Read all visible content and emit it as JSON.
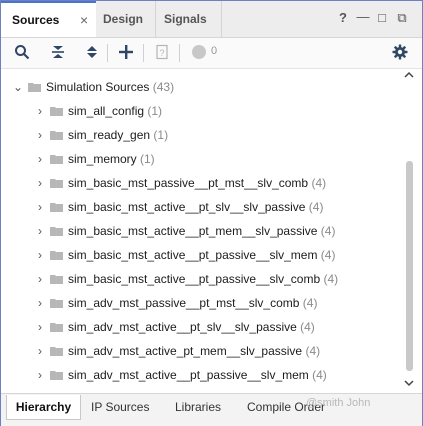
{
  "tabs": {
    "sources": "Sources",
    "design": "Design",
    "signals": "Signals",
    "close_glyph": "×"
  },
  "window_controls": {
    "help": "?",
    "minimize": "—",
    "maximize": "□",
    "restore": "⧉"
  },
  "toolbar": {
    "message_count": "0"
  },
  "tree": {
    "root": {
      "label": "Simulation Sources",
      "count": "(43)"
    },
    "items": [
      {
        "label": "sim_all_config",
        "count": "(1)"
      },
      {
        "label": "sim_ready_gen",
        "count": "(1)"
      },
      {
        "label": "sim_memory",
        "count": "(1)"
      },
      {
        "label": "sim_basic_mst_passive__pt_mst__slv_comb",
        "count": "(4)"
      },
      {
        "label": "sim_basic_mst_active__pt_slv__slv_passive",
        "count": "(4)"
      },
      {
        "label": "sim_basic_mst_active__pt_mem__slv_passive",
        "count": "(4)"
      },
      {
        "label": "sim_basic_mst_active__pt_passive__slv_mem",
        "count": "(4)"
      },
      {
        "label": "sim_basic_mst_active__pt_passive__slv_comb",
        "count": "(4)"
      },
      {
        "label": "sim_adv_mst_passive__pt_mst__slv_comb",
        "count": "(4)"
      },
      {
        "label": "sim_adv_mst_active__pt_slv__slv_passive",
        "count": "(4)"
      },
      {
        "label": "sim_adv_mst_active_pt_mem__slv_passive",
        "count": "(4)"
      },
      {
        "label": "sim_adv_mst_active__pt_passive__slv_mem",
        "count": "(4)"
      }
    ]
  },
  "bottom_tabs": {
    "hierarchy": "Hierarchy",
    "ip_sources": "IP Sources",
    "libraries": "Libraries",
    "compile_order": "Compile Order"
  },
  "watermark": "@smith John",
  "colors": {
    "accent": "#4a74c9",
    "panel_border": "#6f7fc4",
    "folder": "#b7b7b7",
    "count_text": "#8a8a8a"
  }
}
